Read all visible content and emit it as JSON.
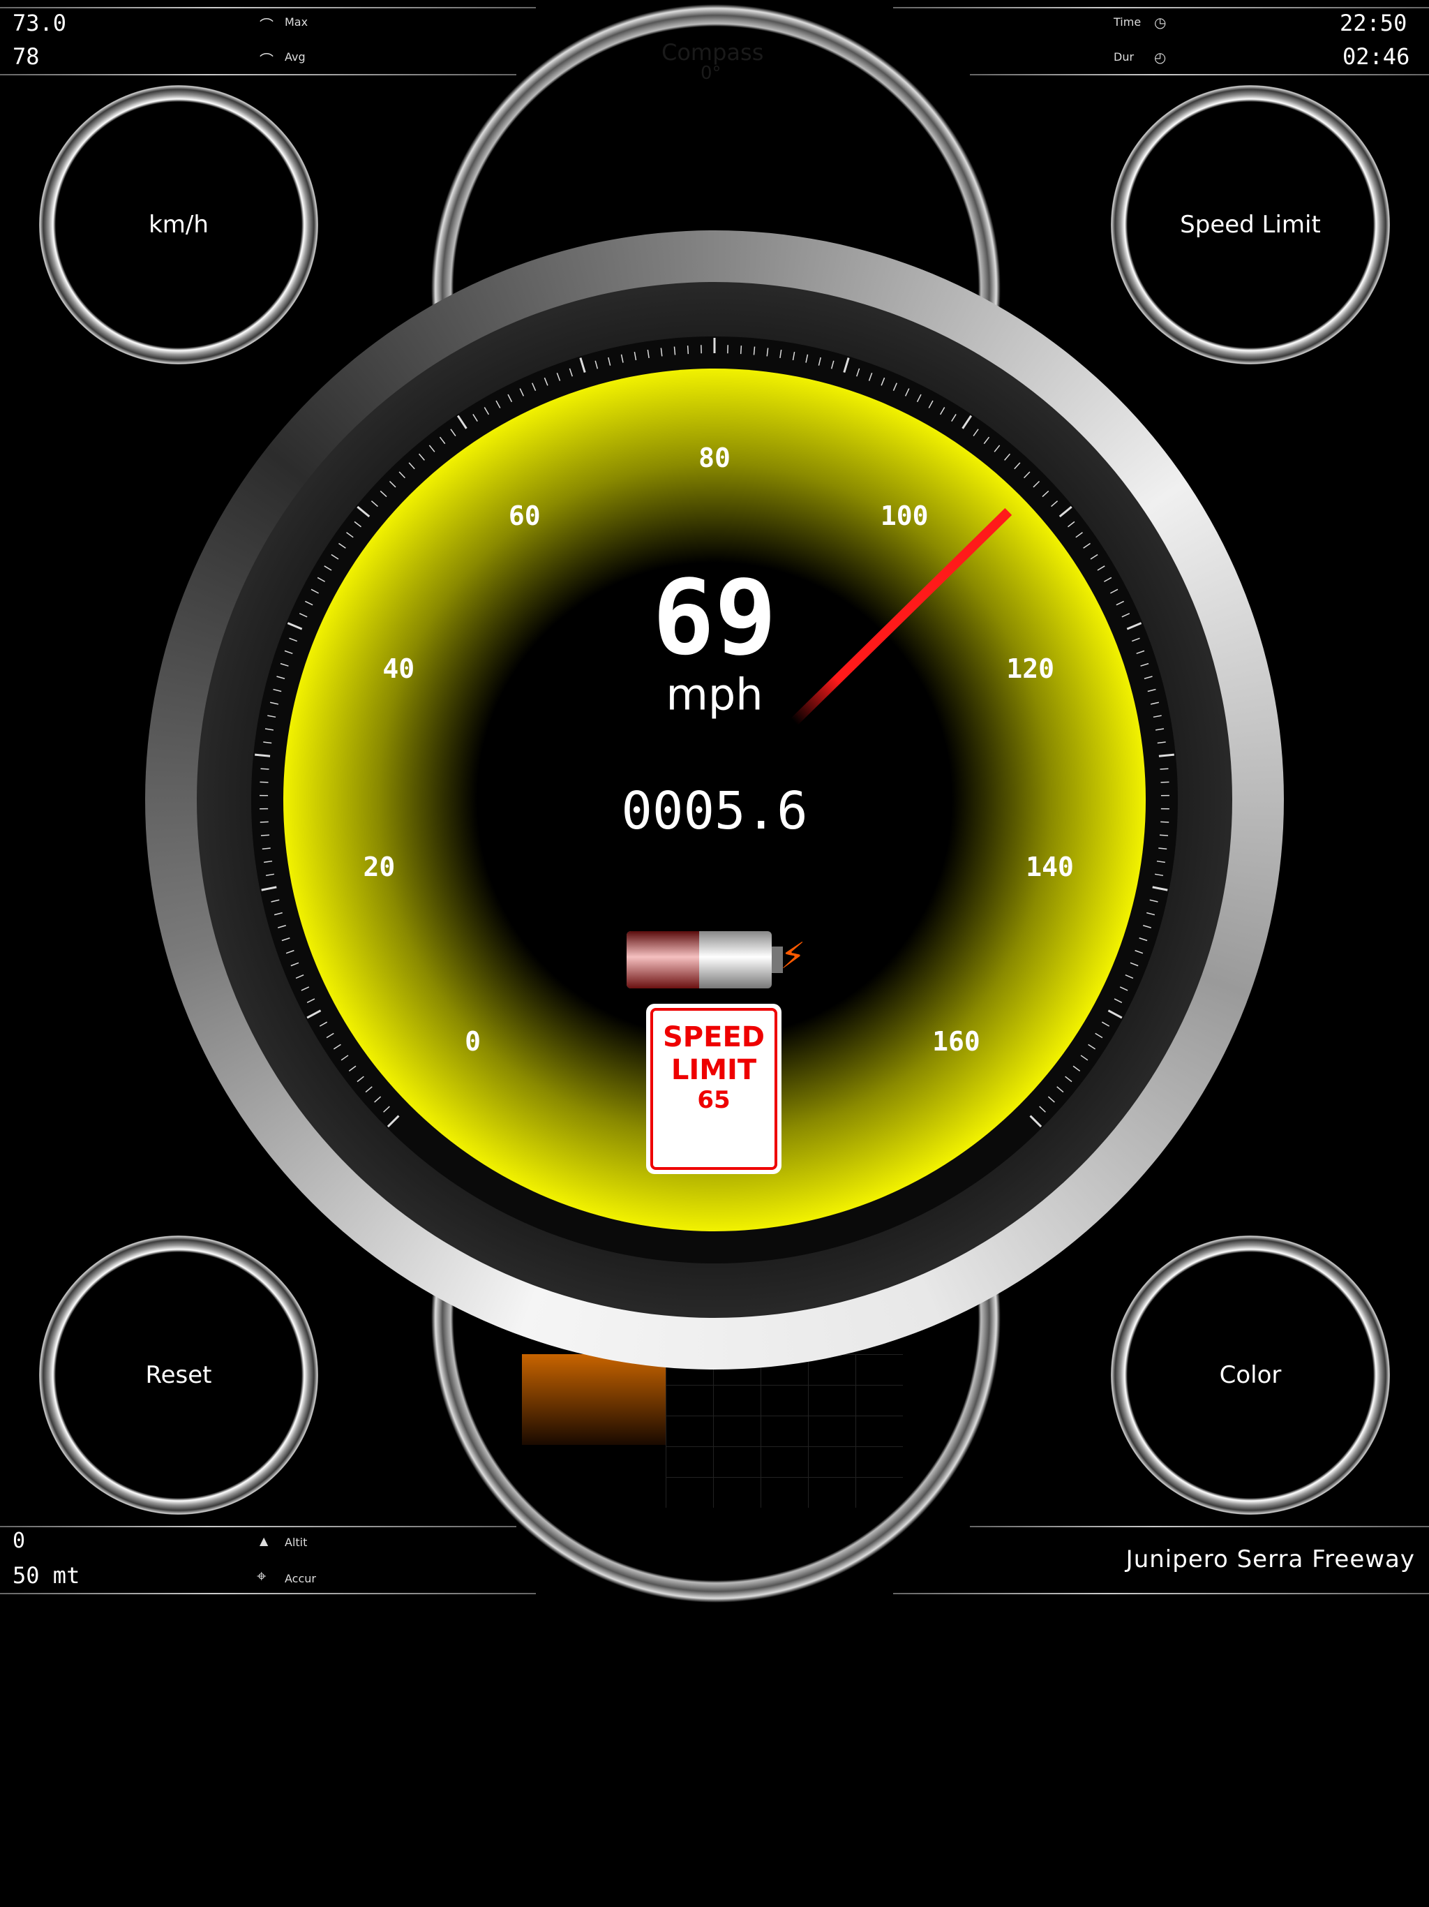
{
  "top_left": {
    "max_value": "73.0",
    "max_label": "Max",
    "avg_value": "78",
    "avg_label": "Avg"
  },
  "top_right": {
    "time_label": "Time",
    "time_value": "22:50",
    "dur_label": "Dur",
    "dur_value": "02:46"
  },
  "compass": {
    "label": "Compass",
    "value": "0°"
  },
  "buttons": {
    "units": "km/h",
    "speed_limit": "Speed Limit",
    "reset": "Reset",
    "color": "Color"
  },
  "gauge": {
    "speed": "69",
    "unit": "mph",
    "odometer": "0005.6",
    "scale_labels": [
      "0",
      "20",
      "40",
      "60",
      "80",
      "100",
      "120",
      "140",
      "160"
    ],
    "needle_speed": 107,
    "battery_level": 0.5,
    "accent_color": "#f2f200",
    "needle_color": "#ff1a1a"
  },
  "speed_limit_sign": {
    "line1": "SPEED",
    "line2": "LIMIT",
    "value": "65"
  },
  "bottom_left": {
    "altit_value": "0",
    "altit_label": "Altit",
    "accur_value": "50 mt",
    "accur_label": "Accur"
  },
  "bottom_right": {
    "street": "Junipero Serra Freeway"
  }
}
